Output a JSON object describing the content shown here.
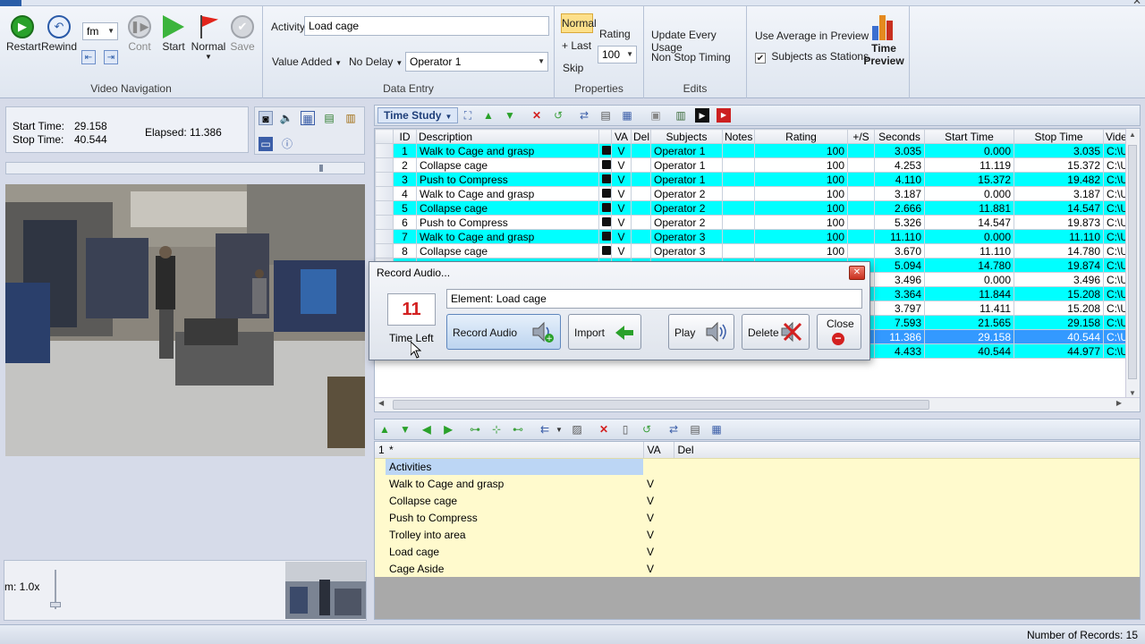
{
  "ribbon": {
    "video_navigation": {
      "label": "Video Navigation",
      "restart": "Restart",
      "rewind": "Rewind",
      "units": "fm",
      "cont": "Cont",
      "start": "Start",
      "normal": "Normal",
      "save": "Save"
    },
    "data_entry": {
      "label": "Data Entry",
      "activity_label": "Activity",
      "activity_value": "Load cage",
      "value_added": "Value Added",
      "no_delay": "No Delay",
      "operator": "Operator 1"
    },
    "properties": {
      "label": "Properties",
      "normal": "Normal",
      "last": "+ Last",
      "skip": "Skip",
      "rating_label": "Rating",
      "rating_value": "100"
    },
    "edits": {
      "label": "Edits",
      "update_every_usage": "Update Every Usage",
      "non_stop_timing": "Non Stop Timing"
    },
    "preview": {
      "use_average": "Use Average in Preview",
      "subjects_as_stations": "Subjects as Stations",
      "time_preview_1": "Time",
      "time_preview_2": "Preview"
    }
  },
  "info": {
    "start_label": "Start Time:",
    "start_value": "29.158",
    "stop_label": "Stop Time:",
    "stop_value": "40.544",
    "elapsed_label": "Elapsed:",
    "elapsed_value": "11.386"
  },
  "zoom": "m: 1.0x",
  "grid_toolbar": {
    "view": "Time Study"
  },
  "columns": [
    "",
    "ID",
    "Description",
    "",
    "VA",
    "Del",
    "Subjects",
    "Notes",
    "Rating",
    "+/S",
    "Seconds",
    "Start Time",
    "Stop Time",
    "Video"
  ],
  "rows": [
    {
      "id": "1",
      "desc": "Walk to Cage and grasp",
      "va": "V",
      "subj": "Operator 1",
      "rating": "100",
      "sec": "3.035",
      "start": "0.000",
      "stop": "3.035",
      "video": "C:\\Us",
      "style": "cyan"
    },
    {
      "id": "2",
      "desc": "Collapse cage",
      "va": "V",
      "subj": "Operator 1",
      "rating": "100",
      "sec": "4.253",
      "start": "11.119",
      "stop": "15.372",
      "video": "C:\\Us",
      "style": "white"
    },
    {
      "id": "3",
      "desc": "Push to Compress",
      "va": "V",
      "subj": "Operator 1",
      "rating": "100",
      "sec": "4.110",
      "start": "15.372",
      "stop": "19.482",
      "video": "C:\\Us",
      "style": "cyan"
    },
    {
      "id": "4",
      "desc": "Walk to Cage and grasp",
      "va": "V",
      "subj": "Operator 2",
      "rating": "100",
      "sec": "3.187",
      "start": "0.000",
      "stop": "3.187",
      "video": "C:\\Us",
      "style": "white"
    },
    {
      "id": "5",
      "desc": "Collapse cage",
      "va": "V",
      "subj": "Operator 2",
      "rating": "100",
      "sec": "2.666",
      "start": "11.881",
      "stop": "14.547",
      "video": "C:\\Us",
      "style": "cyan"
    },
    {
      "id": "6",
      "desc": "Push to Compress",
      "va": "V",
      "subj": "Operator 2",
      "rating": "100",
      "sec": "5.326",
      "start": "14.547",
      "stop": "19.873",
      "video": "C:\\Us",
      "style": "white"
    },
    {
      "id": "7",
      "desc": "Walk to Cage and grasp",
      "va": "V",
      "subj": "Operator 3",
      "rating": "100",
      "sec": "11.110",
      "start": "0.000",
      "stop": "11.110",
      "video": "C:\\Us",
      "style": "cyan"
    },
    {
      "id": "8",
      "desc": "Collapse cage",
      "va": "V",
      "subj": "Operator 3",
      "rating": "100",
      "sec": "3.670",
      "start": "11.110",
      "stop": "14.780",
      "video": "C:\\Us",
      "style": "white"
    },
    {
      "id": "",
      "desc": "",
      "va": "",
      "subj": "",
      "rating": "",
      "sec": "5.094",
      "start": "14.780",
      "stop": "19.874",
      "video": "C:\\Us",
      "style": "cyan"
    },
    {
      "id": "",
      "desc": "",
      "va": "",
      "subj": "",
      "rating": "",
      "sec": "3.496",
      "start": "0.000",
      "stop": "3.496",
      "video": "C:\\Us",
      "style": "white"
    },
    {
      "id": "",
      "desc": "",
      "va": "",
      "subj": "",
      "rating": "",
      "sec": "3.364",
      "start": "11.844",
      "stop": "15.208",
      "video": "C:\\Us",
      "style": "cyan"
    },
    {
      "id": "",
      "desc": "",
      "va": "",
      "subj": "",
      "rating": "",
      "sec": "3.797",
      "start": "11.411",
      "stop": "15.208",
      "video": "C:\\Us",
      "style": "white"
    },
    {
      "id": "",
      "desc": "",
      "va": "",
      "subj": "",
      "rating": "",
      "sec": "7.593",
      "start": "21.565",
      "stop": "29.158",
      "video": "C:\\Us",
      "style": "cyan"
    },
    {
      "id": "",
      "desc": "",
      "va": "",
      "subj": "",
      "rating": "",
      "sec": "11.386",
      "start": "29.158",
      "stop": "40.544",
      "video": "C:\\Us",
      "style": "sel"
    },
    {
      "id": "",
      "desc": "",
      "va": "",
      "subj": "",
      "rating": "",
      "sec": "4.433",
      "start": "40.544",
      "stop": "44.977",
      "video": "C:\\Us",
      "style": "cyan"
    }
  ],
  "activities": {
    "header_num": "1",
    "header_star": "*",
    "header_va": "VA",
    "header_del": "Del",
    "group": "Activities",
    "items": [
      {
        "name": "Walk to Cage and grasp",
        "va": "V"
      },
      {
        "name": "Collapse cage",
        "va": "V"
      },
      {
        "name": "Push to Compress",
        "va": "V"
      },
      {
        "name": "Trolley into area",
        "va": "V"
      },
      {
        "name": "Load cage",
        "va": "V"
      },
      {
        "name": "Cage Aside",
        "va": "V"
      }
    ]
  },
  "dialog": {
    "title": "Record Audio...",
    "time_left_value": "11",
    "time_left_label": "Time Left",
    "element": "Element: Load cage",
    "record_audio": "Record Audio",
    "import": "Import",
    "play": "Play",
    "delete": "Delete",
    "close": "Close"
  },
  "status": {
    "records": "Number of Records: 15"
  },
  "colors": {
    "cyan_row": "#00ffff",
    "selected_row": "#3399ff",
    "activity_bg": "#fffacd"
  }
}
